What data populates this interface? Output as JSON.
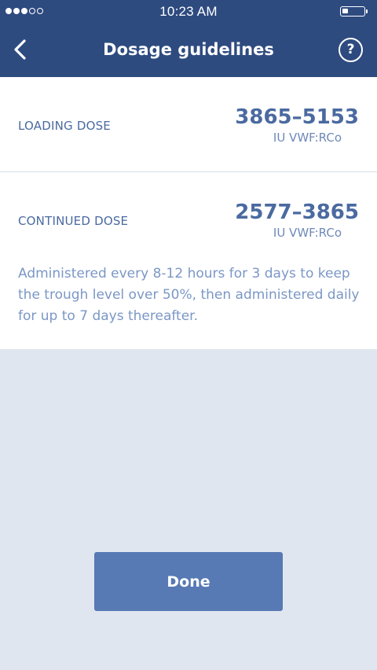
{
  "status_bar": {
    "time": "10:23 AM",
    "signal_strength_bars": 3,
    "signal_total_bars": 5,
    "battery_level": 0.25
  },
  "nav": {
    "title": "Dosage guidelines",
    "back_icon": "chevron-left-icon",
    "help_label": "?"
  },
  "loading_dose": {
    "label": "LOADING DOSE",
    "value": "3865–5153",
    "unit": "IU VWF:RCo"
  },
  "continued_dose": {
    "label": "CONTINUED DOSE",
    "value": "2577–3865",
    "unit": "IU VWF:RCo",
    "note": "Administered every 8-12 hours for 3 days to keep the trough level over 50%, then administered daily for up to 7 days thereafter."
  },
  "done_label": "Done",
  "colors": {
    "nav_background": "#2e4b80",
    "accent": "#4a6aa0",
    "button": "#5779b4",
    "page_background": "#e0e6f0"
  }
}
